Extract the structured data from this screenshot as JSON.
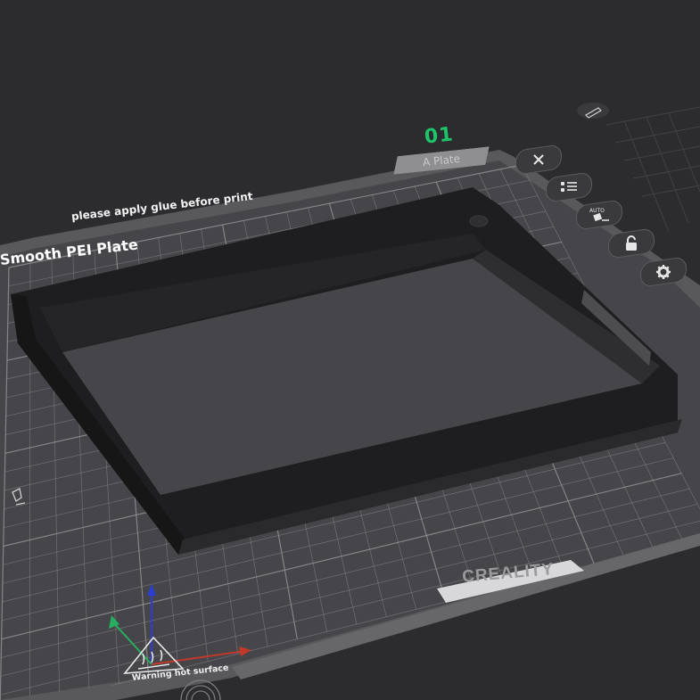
{
  "plate": {
    "number": "01",
    "name": "A Plate",
    "bed_type": "Smooth PEI Plate",
    "glue_notice": "please apply glue before print",
    "brand": "CREALITY",
    "warning": "Warning hot surface"
  },
  "plate_toolbar": {
    "buttons": [
      {
        "name": "close-plate-button",
        "icon": "close-icon"
      },
      {
        "name": "arrange-button",
        "icon": "arrange-list-icon"
      },
      {
        "name": "auto-orient-button",
        "icon": "auto-orient-icon",
        "label": "AUTO"
      },
      {
        "name": "lock-plate-button",
        "icon": "lock-icon"
      },
      {
        "name": "plate-settings-button",
        "icon": "gear-icon"
      }
    ],
    "edit_icon": "pencil-icon"
  },
  "colors": {
    "background": "#2c2c2f",
    "bed_surface": "#4a4a4d",
    "grid_line": "#9a9a9d",
    "model": "#1f1f21",
    "plate_number": "#1fc46a",
    "axis_x": "#c0392b",
    "axis_y": "#27ae60",
    "axis_z": "#2a3fd1"
  }
}
